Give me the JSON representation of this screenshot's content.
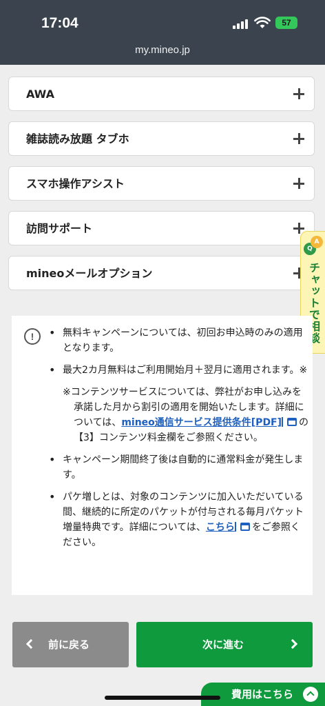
{
  "status_bar": {
    "time": "17:04",
    "battery": "57",
    "url": "my.mineo.jp"
  },
  "accordion": {
    "items": [
      {
        "label": "AWA"
      },
      {
        "label": "雑誌読み放題 タブホ"
      },
      {
        "label": "スマホ操作アシスト"
      },
      {
        "label": "訪問サポート"
      },
      {
        "label": "mineoメールオプション"
      }
    ]
  },
  "chat_tab": {
    "label": "チャットで相談",
    "icon_a": "A",
    "icon_q": "Q"
  },
  "notes": {
    "icon": "!",
    "item1": "無料キャンペーンについては、初回お申込時のみの適用となります。",
    "item2": "最大2カ月無料はご利用開始月＋翌月に適用されます。※",
    "item2_sub_before": "※コンテンツサービスについては、弊社がお申し込みを承諾した月から割引の適用を開始いたします。詳細については、",
    "item2_sub_link": "mineo通信サービス提供条件[PDF]",
    "item2_sub_after": "の【3】コンテンツ料金欄をご参照ください。",
    "item3": "キャンペーン期間終了後は自動的に通常料金が発生します。",
    "item4_before": "パケ増しとは、対象のコンテンツに加入いただいている間、継続的に所定のパケットが付与される毎月パケット増量特典です。詳細については、",
    "item4_link": "こちら",
    "item4_after": "をご参照ください。"
  },
  "navigation": {
    "prev_label": "前に戻る",
    "next_label": "次に進む"
  },
  "fee_tab": {
    "label": "費用はこちら"
  },
  "colors": {
    "header_bg": "#3b444e",
    "primary_green": "#109a3e",
    "prev_gray": "#8b8b8b",
    "link_blue": "#1d5fbf",
    "chat_bg": "#fdf5b5"
  }
}
